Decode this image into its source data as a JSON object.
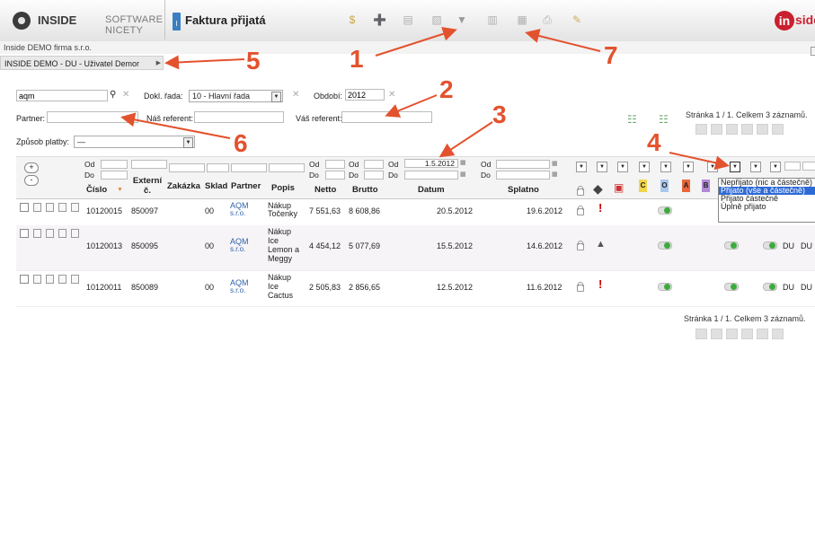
{
  "header": {
    "brand_name": "INSIDE",
    "brand_tagline": "SOFTWARE NICETY",
    "doc_icon_text": "I",
    "doc_title": "Faktura přijatá",
    "right_logo_letter": "in",
    "right_logo_text": "side",
    "toolbar_icons": [
      "dollar-icon",
      "add-icon",
      "edit-icon",
      "copy-icon",
      "filter-icon",
      "export-icon",
      "import-icon",
      "print-icon",
      "pin-icon"
    ]
  },
  "company": {
    "name": "Inside DEMO firma s.r.o.",
    "user": "INSIDE DEMO - DU - Uživatel Demor"
  },
  "filter": {
    "search_value": "aqm",
    "dokl_rada_label": "Dokl. řada:",
    "dokl_rada_value": "10 - Hlavní řada",
    "obdobi_label": "Období:",
    "obdobi_value": "2012",
    "partner_label": "Partner:",
    "nas_referent_label": "Náš referent:",
    "vas_referent_label": "Váš referent:",
    "zpusob_platby_label": "Způsob platby:",
    "zpusob_platby_value": "—"
  },
  "pager": {
    "top_text": "Stránka 1 / 1. Celkem 3 záznamů.",
    "bottom_text": "Stránka 1 / 1. Celkem 3 záznamů."
  },
  "table": {
    "filter_labels": {
      "od": "Od",
      "do": "Do"
    },
    "date_filter_value": "1.5.2012",
    "columns": {
      "cislo": "Číslo",
      "externi": "Externí č.",
      "zakazka": "Zakázka",
      "sklad": "Sklad",
      "partner": "Partner",
      "popis": "Popis",
      "netto": "Netto",
      "brutto": "Brutto",
      "datum": "Datum",
      "splatno": "Splatno"
    },
    "color_cols": [
      "C",
      "O",
      "A",
      "B"
    ],
    "rows": [
      {
        "cislo": "10120015",
        "externi": "850097",
        "sklad": "00",
        "partner_a": "AQM",
        "partner_b": "s.r.o.",
        "popis": [
          "Nákup",
          "Točenky"
        ],
        "netto": "7 551,63",
        "brutto": "8 608,86",
        "datum": "20.5.2012",
        "splatno": "19.6.2012",
        "du1": "",
        "du2": ""
      },
      {
        "cislo": "10120013",
        "externi": "850095",
        "sklad": "00",
        "partner_a": "AQM",
        "partner_b": "s.r.o.",
        "popis": [
          "Nákup",
          "Ice",
          "Lemon a",
          "Meggy"
        ],
        "netto": "4 454,12",
        "brutto": "5 077,69",
        "datum": "15.5.2012",
        "splatno": "14.6.2012",
        "du1": "DU",
        "du2": "DU"
      },
      {
        "cislo": "10120011",
        "externi": "850089",
        "sklad": "00",
        "partner_a": "AQM",
        "partner_b": "s.r.o.",
        "popis": [
          "Nákup",
          "Ice",
          "Cactus"
        ],
        "netto": "2 505,83",
        "brutto": "2 856,65",
        "datum": "12.5.2012",
        "splatno": "11.6.2012",
        "du1": "DU",
        "du2": "DU"
      }
    ]
  },
  "dropdown": {
    "options": [
      "Nepřijato (nic a částečně)",
      "Přijato (vše a částečně)",
      "Přijato částečně",
      "Úplně přijato"
    ],
    "selected_index": 1
  },
  "annotations": [
    "1",
    "2",
    "3",
    "4",
    "5",
    "6",
    "7"
  ],
  "colors": {
    "accent": "#e3522e",
    "link": "#2f63a8",
    "brand_red": "#c9202f",
    "selection": "#2e6ad6"
  }
}
